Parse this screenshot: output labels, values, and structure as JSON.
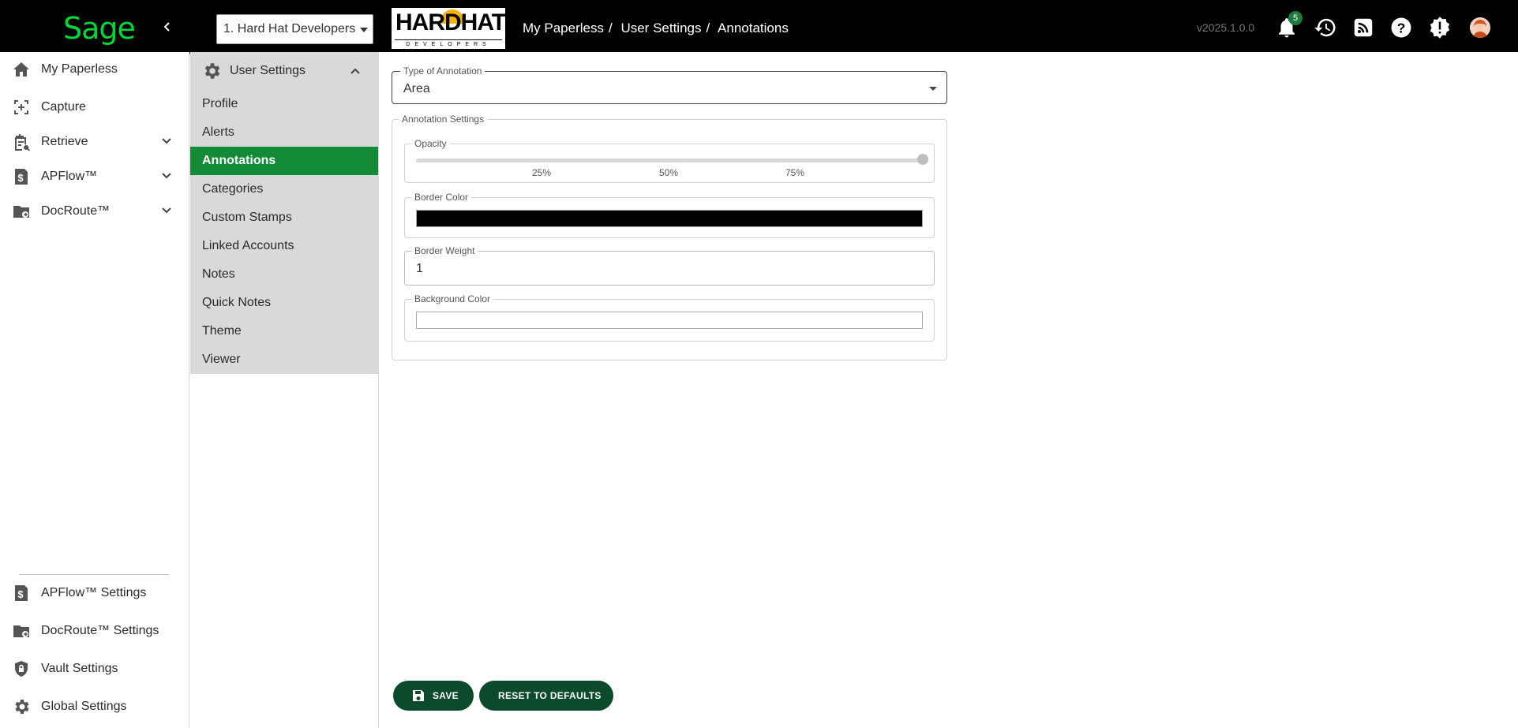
{
  "brand": {
    "logo_text": "Sage",
    "collapse_icon": "chevron-left"
  },
  "header": {
    "company_select": "1. Hard Hat Developers",
    "company_logo_big": "HARDHAT",
    "company_logo_small": "DEVELOPERS",
    "breadcrumb": [
      "My Paperless",
      "User Settings",
      "Annotations"
    ],
    "breadcrumb_sep": "/",
    "version": "v2025.1.0.0",
    "notification_count": "5"
  },
  "leftnav": {
    "items": [
      {
        "label": "My Paperless",
        "icon": "home-icon"
      },
      {
        "label": "Capture",
        "icon": "capture-icon"
      },
      {
        "label": "Retrieve",
        "icon": "retrieve-icon",
        "expandable": true
      },
      {
        "label": "APFlow™",
        "icon": "dollar-doc-icon",
        "expandable": true
      },
      {
        "label": "DocRoute™",
        "icon": "folder-route-icon",
        "expandable": true
      }
    ],
    "bottom_items": [
      {
        "label": "APFlow™ Settings",
        "icon": "dollar-doc-icon"
      },
      {
        "label": "DocRoute™ Settings",
        "icon": "folder-route-icon"
      },
      {
        "label": "Vault Settings",
        "icon": "shield-lock-icon"
      },
      {
        "label": "Global Settings",
        "icon": "gear-icon"
      }
    ]
  },
  "submenu": {
    "title": "User Settings",
    "items": [
      "Profile",
      "Alerts",
      "Annotations",
      "Categories",
      "Custom Stamps",
      "Linked Accounts",
      "Notes",
      "Quick Notes",
      "Theme",
      "Viewer"
    ],
    "active": "Annotations"
  },
  "main": {
    "type_label": "Type of Annotation",
    "type_value": "Area",
    "settings_label": "Annotation Settings",
    "opacity_label": "Opacity",
    "opacity_value": 1.0,
    "opacity_ticks": [
      "25%",
      "50%",
      "75%"
    ],
    "border_color_label": "Border Color",
    "border_color": "#000000",
    "border_weight_label": "Border Weight",
    "border_weight": "1",
    "background_color_label": "Background Color",
    "background_color": "#ffffff",
    "save_label": "SAVE",
    "reset_label": "RESET TO DEFAULTS"
  },
  "colors": {
    "accent": "#138a36",
    "button": "#0b4a2a",
    "brand_green": "#00d639"
  }
}
